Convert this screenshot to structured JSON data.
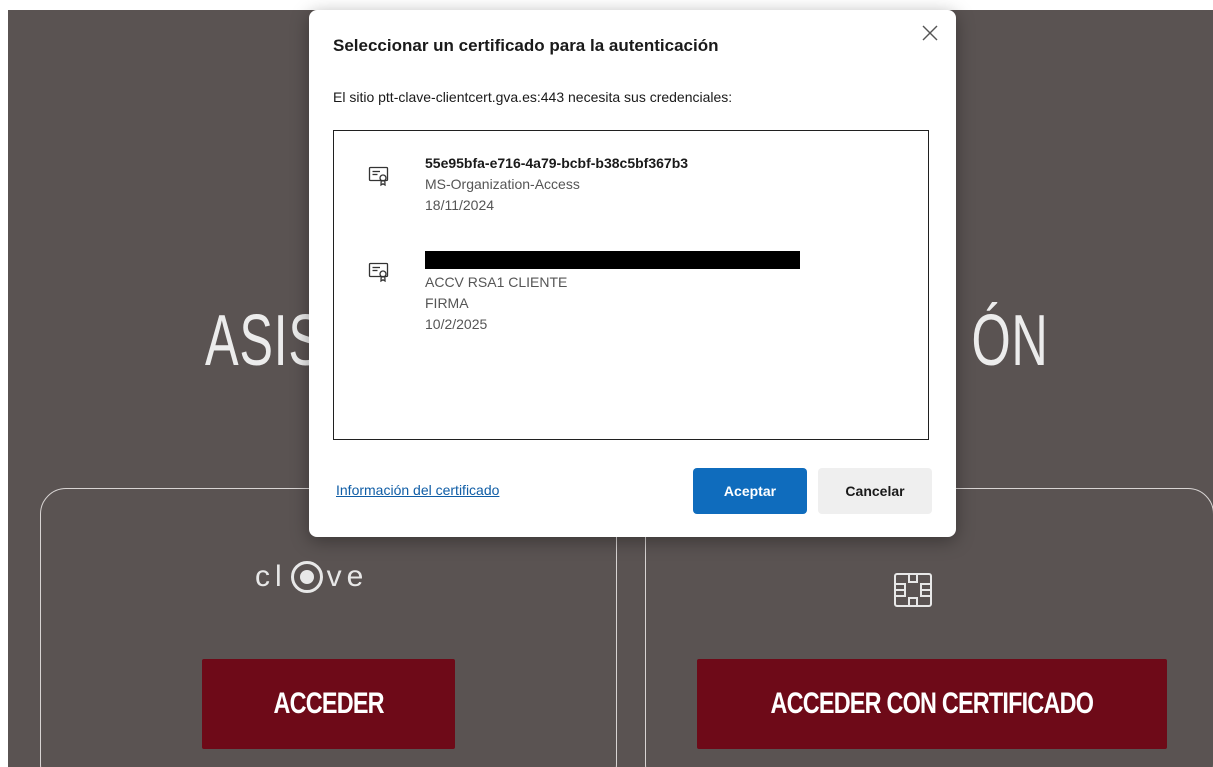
{
  "background": {
    "hero_left": "ASIS",
    "hero_right": "ÓN",
    "clave_logo_text": {
      "before": "cl",
      "after": "ve"
    },
    "left_card": {
      "button_label": "ACCEDER"
    },
    "right_card": {
      "button_label": "ACCEDER CON CERTIFICADO"
    },
    "colors": {
      "panel": "#5a5352",
      "button": "#6e0a18"
    }
  },
  "dialog": {
    "title": "Seleccionar un certificado para la autenticación",
    "subtitle": "El sitio ptt-clave-clientcert.gva.es:443 necesita sus credenciales:",
    "certificates": [
      {
        "name": "55e95bfa-e716-4a79-bcbf-b38c5bf367b3",
        "issuer": "MS-Organization-Access",
        "date": "18/11/2024",
        "icon": "certificate-icon"
      },
      {
        "name_redacted": true,
        "issuer": "ACCV RSA1 CLIENTE",
        "purpose": "FIRMA",
        "date": "10/2/2025",
        "icon": "certificate-icon"
      }
    ],
    "info_link": "Información del certificado",
    "accept_label": "Aceptar",
    "cancel_label": "Cancelar",
    "close_icon": "close-icon",
    "colors": {
      "accept": "#0f6cbd",
      "link": "#0f5da6"
    }
  }
}
